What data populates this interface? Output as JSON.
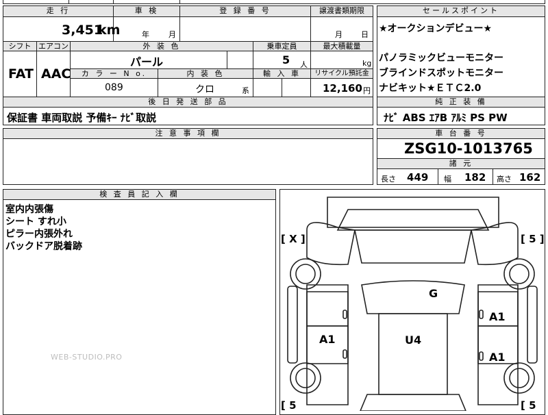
{
  "top_cut": {
    "left": "",
    "right": "",
    "mid_a": "",
    "mid_b": ""
  },
  "row1_headers": {
    "mileage": "走 行",
    "shaken": "車 検",
    "reg_no": "登 録 番 号",
    "transfer": "譲渡書類期限",
    "sales_points": "セールスポイント"
  },
  "mileage": {
    "value": "3,451",
    "unit": "km"
  },
  "shaken": {
    "year": "年",
    "month": "月"
  },
  "transfer": {
    "month": "月",
    "day": "日"
  },
  "row2_headers": {
    "shift": "シフト",
    "aircon": "エアコン",
    "ext_color": "外 装 色",
    "capacity": "乗車定員",
    "max_load": "最大積載量"
  },
  "shift": "FAT",
  "aircon": "AAC",
  "ext_color": "パール",
  "capacity": {
    "value": "5",
    "unit": "人"
  },
  "max_load": {
    "unit": "kg"
  },
  "row3_headers": {
    "color_no": "カ ラ ー N o.",
    "int_color": "内 装 色",
    "import": "輸 入 車",
    "recycle": "リサイクル預託金"
  },
  "color_no": "089",
  "int_color": {
    "value": "クロ",
    "suffix": "系"
  },
  "recycle": {
    "value": "12,160",
    "unit": "円"
  },
  "sales_points": [
    "★オークションデビュー★",
    "",
    "パノラミックビューモニター",
    "ブラインドスポットモニター",
    "ナビキット★ＥＴＣ2.0"
  ],
  "later_parts": {
    "header": "後 日 発 送 部 品",
    "items": "保証書 車両取説 予備ｷｰ ﾅﾋﾞ取説"
  },
  "genuine": {
    "header": "純 正 装 備",
    "items": "ﾅﾋﾞ ABS ｴｱB ｱﾙﾐ PS PW"
  },
  "notes": {
    "header": "注 意 事 項 欄"
  },
  "chassis": {
    "header": "車 台 番 号",
    "value": "ZSG10-1013765"
  },
  "specs": {
    "header": "諸 元",
    "length_label": "長さ",
    "length": "449",
    "width_label": "幅",
    "width": "182",
    "height_label": "高さ",
    "height": "162"
  },
  "inspector": {
    "header": "検 査 員 記 入 欄",
    "lines": [
      "室内内張傷",
      "シート すれ小",
      "ピラー内張外れ",
      "バックドア脱着跡"
    ]
  },
  "watermark": "WEB-STUDIO.PRO",
  "diagram": {
    "front_left": "[ X ]",
    "front_right": "[ 5 ]",
    "rear_left": "[ 5",
    "rear_right": "[ 5",
    "marks": {
      "roof": "G",
      "right_front": "A1",
      "left_side": "A1",
      "center": "U4",
      "right_rear": "A1"
    }
  }
}
